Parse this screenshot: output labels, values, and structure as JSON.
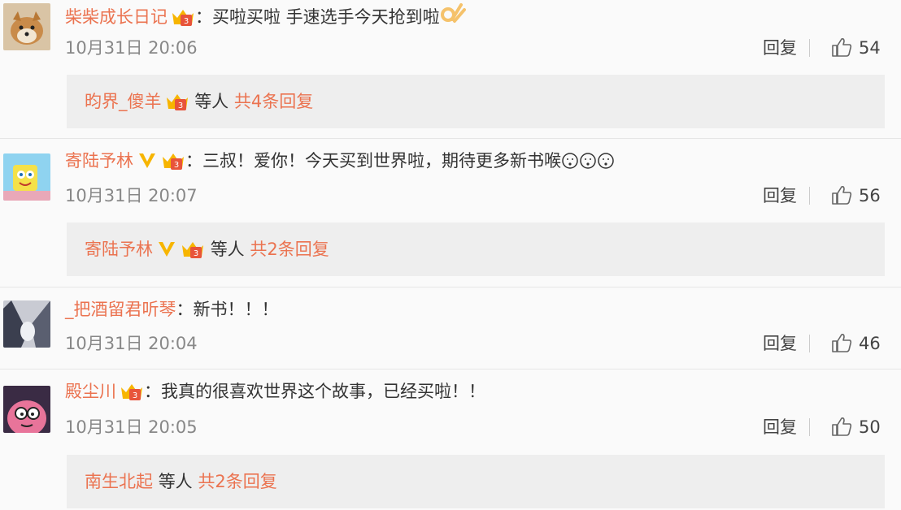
{
  "comments": [
    {
      "username": "柴柴成长日记",
      "text": "：买啦买啦 手速选手今天抢到啦",
      "time": "10月31日 20:06",
      "reply_label": "回复",
      "likes": "54",
      "replies": {
        "name": "昀界_傻羊",
        "middle": "等人",
        "count": "共4条回复"
      }
    },
    {
      "username": "寄陆予林",
      "text": "：三叔！爱你！今天买到世界啦，期待更多新书喉",
      "time": "10月31日 20:07",
      "reply_label": "回复",
      "likes": "56",
      "replies": {
        "name": "寄陆予林",
        "middle": "等人",
        "count": "共2条回复"
      }
    },
    {
      "username": "_把酒留君听琴",
      "text": "：新书！！！",
      "time": "10月31日 20:04",
      "reply_label": "回复",
      "likes": "46"
    },
    {
      "username": "殿尘川",
      "text": "：我真的很喜欢世界这个故事，已经买啦！！",
      "time": "10月31日 20:05",
      "reply_label": "回复",
      "likes": "50",
      "replies": {
        "name": "南生北起",
        "middle": "等人",
        "count": "共2条回复"
      }
    }
  ],
  "colors": {
    "username": "#eb7350",
    "reply_box": "#eeeeee",
    "vip_gold": "#f7b500"
  }
}
